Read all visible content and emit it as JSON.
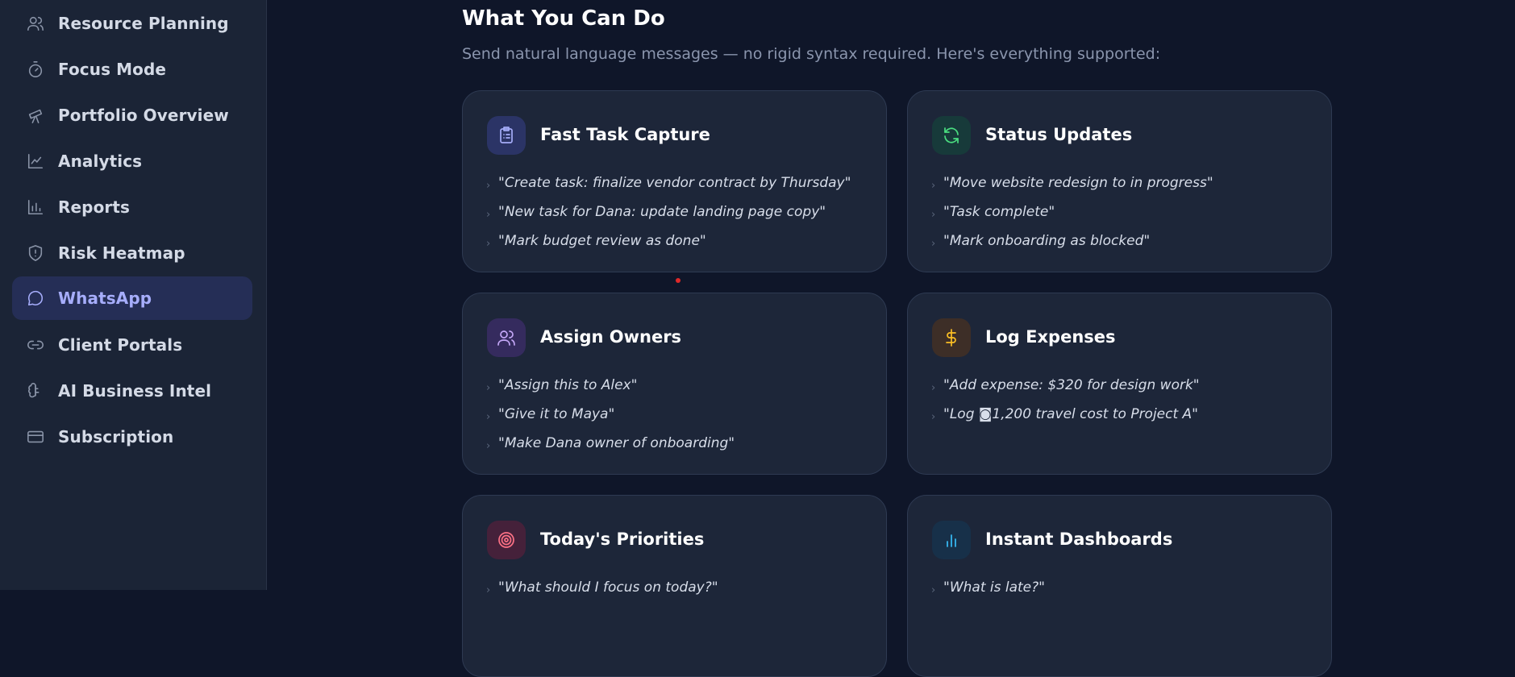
{
  "sidebar": {
    "items": [
      {
        "label": "Resource Planning",
        "icon": "users-icon",
        "active": false
      },
      {
        "label": "Focus Mode",
        "icon": "timer-icon",
        "active": false
      },
      {
        "label": "Portfolio Overview",
        "icon": "telescope-icon",
        "active": false
      },
      {
        "label": "Analytics",
        "icon": "line-chart-icon",
        "active": false
      },
      {
        "label": "Reports",
        "icon": "bar-chart-icon",
        "active": false
      },
      {
        "label": "Risk Heatmap",
        "icon": "shield-alert-icon",
        "active": false
      },
      {
        "label": "WhatsApp",
        "icon": "message-circle-icon",
        "active": true
      },
      {
        "label": "Client Portals",
        "icon": "link-icon",
        "active": false
      },
      {
        "label": "AI Business Intel",
        "icon": "brain-icon",
        "active": false
      },
      {
        "label": "Subscription",
        "icon": "credit-card-icon",
        "active": false
      }
    ]
  },
  "main": {
    "title": "What You Can Do",
    "subtitle": "Send natural language messages — no rigid syntax required. Here's everything supported:",
    "cards": [
      {
        "title": "Fast Task Capture",
        "icon": "clipboard-list-icon",
        "icon_color": "#a5acf8",
        "icon_bg": "#2b3466",
        "examples": [
          "\"Create task: finalize vendor contract by Thursday\"",
          "\"New task for Dana: update landing page copy\"",
          "\"Mark budget review as done\""
        ]
      },
      {
        "title": "Status Updates",
        "icon": "refresh-icon",
        "icon_color": "#4ade80",
        "icon_bg": "#173a3a",
        "examples": [
          "\"Move website redesign to in progress\"",
          "\"Task complete\"",
          "\"Mark onboarding as blocked\""
        ]
      },
      {
        "title": "Assign Owners",
        "icon": "users-icon",
        "icon_color": "#c4a7f7",
        "icon_bg": "#352b5e",
        "examples": [
          "\"Assign this to Alex\"",
          "\"Give it to Maya\"",
          "\"Make Dana owner of onboarding\""
        ]
      },
      {
        "title": "Log Expenses",
        "icon": "dollar-icon",
        "icon_color": "#fbbf24",
        "icon_bg": "#3d2e27",
        "examples": [
          "\"Add expense: $320 for design work\"",
          "\"Log ◙1,200 travel cost to Project A\""
        ]
      },
      {
        "title": "Today's Priorities",
        "icon": "target-icon",
        "icon_color": "#fb7185",
        "icon_bg": "#45213a",
        "examples": [
          "\"What should I focus on today?\""
        ]
      },
      {
        "title": "Instant Dashboards",
        "icon": "bar-chart-icon",
        "icon_color": "#38bdf8",
        "icon_bg": "#173049",
        "examples": [
          "\"What is late?\""
        ]
      }
    ]
  }
}
